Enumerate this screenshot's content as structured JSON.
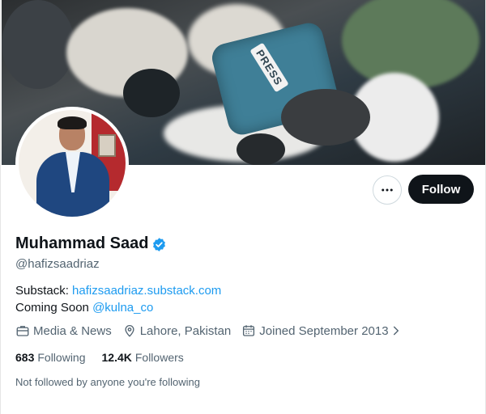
{
  "profile": {
    "name": "Muhammad Saad",
    "handle": "@hafizsaadriaz",
    "verified": true,
    "follow_label": "Follow",
    "more_label": "More"
  },
  "banner": {
    "press_text": "PRESS"
  },
  "bio": {
    "line1_prefix": "Substack: ",
    "line1_link": "hafizsaadriaz.substack.com",
    "line2_prefix": "Coming Soon ",
    "line2_link": "@kulna_co"
  },
  "meta": {
    "category": "Media & News",
    "location": "Lahore, Pakistan",
    "joined": "Joined September 2013"
  },
  "stats": {
    "following_count": "683",
    "following_label": "Following",
    "followers_count": "12.4K",
    "followers_label": "Followers"
  },
  "followed_note": "Not followed by anyone you're following",
  "colors": {
    "accent": "#1d9bf0",
    "text": "#0f1419",
    "secondary": "#536471",
    "button_bg": "#0f1419"
  },
  "icons": {
    "more": "ellipsis-icon",
    "verified": "verified-badge-icon",
    "category": "briefcase-icon",
    "location": "location-pin-icon",
    "joined": "calendar-icon",
    "expand": "chevron-right-icon"
  }
}
